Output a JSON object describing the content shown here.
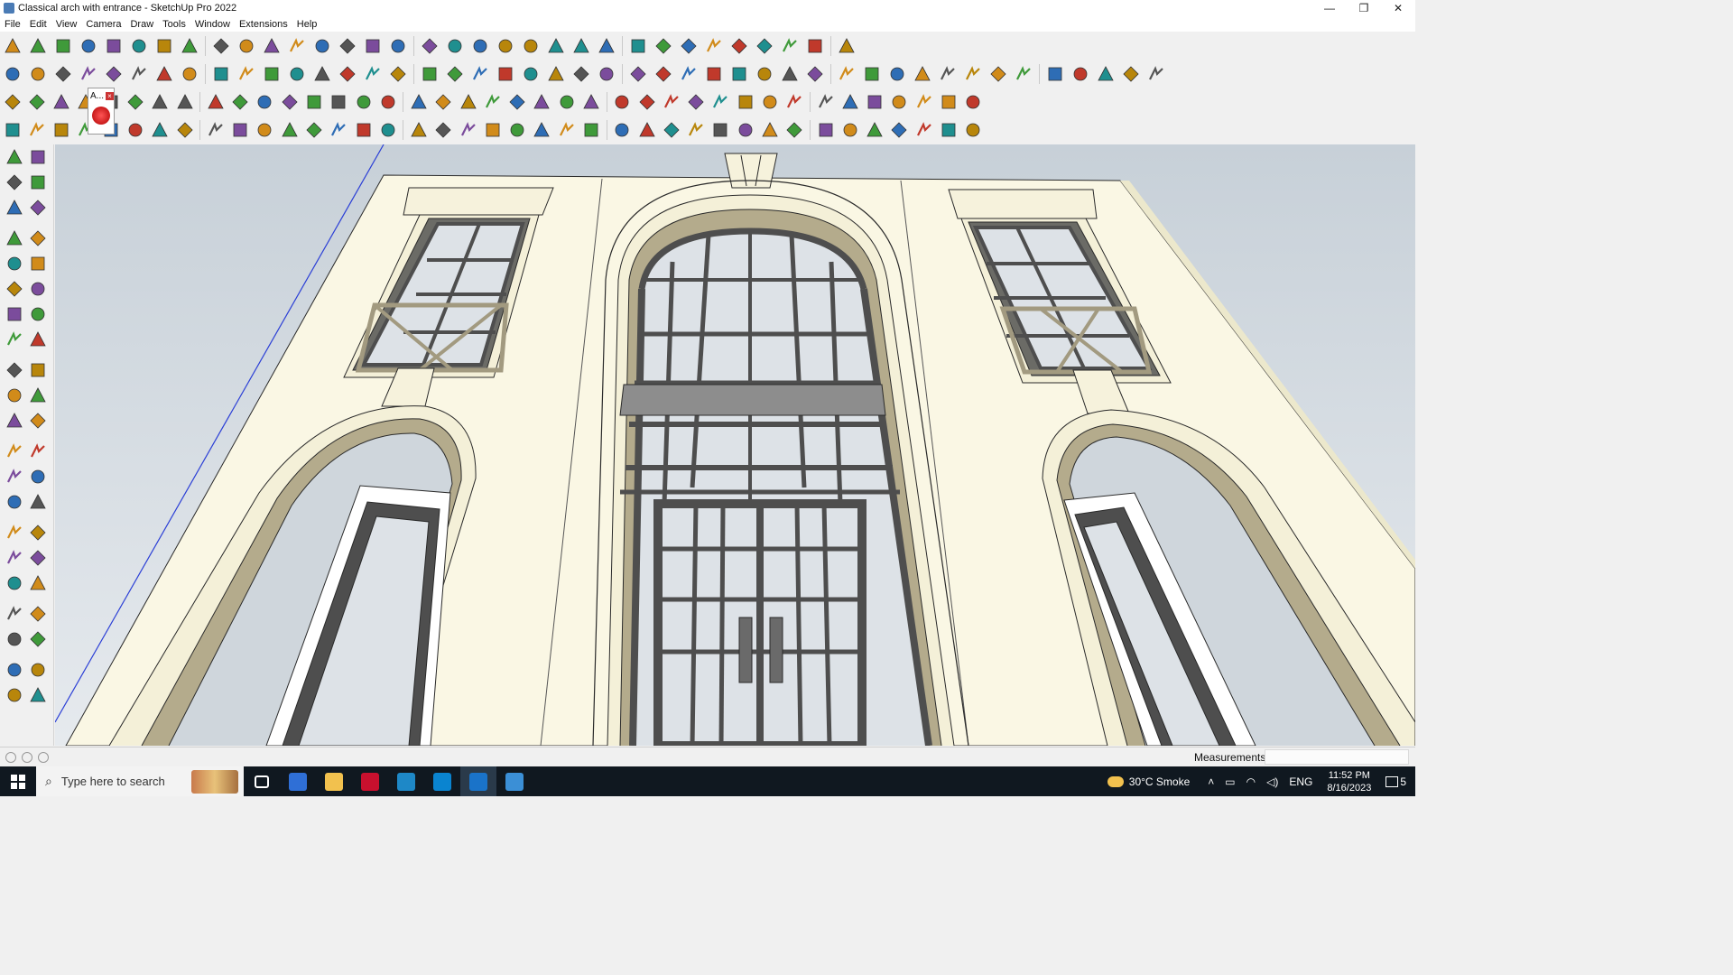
{
  "window": {
    "title": "Classical arch with entrance - SketchUp Pro 2022",
    "controls": [
      "—",
      "❐",
      "✕"
    ]
  },
  "menubar": [
    "File",
    "Edit",
    "View",
    "Camera",
    "Draw",
    "Tools",
    "Window",
    "Extensions",
    "Help"
  ],
  "toolbars": {
    "row1": [
      "zoom-icon",
      "select-icon",
      "eraser-icon",
      "pencil-icon",
      "arc-icon",
      "rectangle-icon",
      "push-pull-icon",
      "follow-me-icon",
      "move-icon",
      "rotate-icon",
      "scale-icon",
      "tape-measure-icon",
      "text-icon",
      "paint-bucket-icon",
      "orbit-icon",
      "pan-icon",
      "zoom-window-icon",
      "zoom-extents-icon",
      "x-ray-icon",
      "back-edges-icon",
      "wireframe-icon",
      "hidden-line-icon",
      "shaded-icon",
      "component-icon",
      "group-icon",
      "section-plane-icon",
      "flip-icon",
      "swap-icon",
      "measure-icon",
      "3d-warehouse-icon",
      "undo-icon",
      "redo-icon",
      "hand-stop-icon"
    ],
    "row2": [
      "cube-icon",
      "cube-gray-icon",
      "cube-white-icon",
      "push-icon",
      "arrow-n-icon",
      "arrow-e-icon",
      "arrow-r-icon",
      "arrow-g-icon",
      "arrow-k-icon",
      "arrow-o-icon",
      "arrow-p-icon",
      "curve-icon",
      "blue-panel-icon",
      "blue-panel-2-icon",
      "blue-panel-3-icon",
      "green-tile-icon",
      "green-node-icon",
      "house-1-icon",
      "house-2-icon",
      "house-3-icon",
      "house-4-icon",
      "house-5-icon",
      "house-6-icon",
      "fx-icon",
      "tag-icon",
      "ruler-icon",
      "shape-1-icon",
      "shape-2-icon",
      "shape-3-icon",
      "shape-4-icon",
      "shape-5-icon",
      "shape-6-icon",
      "shape-7-icon",
      "shape-8-icon",
      "shape-9-icon",
      "shape-10-icon",
      "red-pencil-icon",
      "red-eraser-icon",
      "material-1-icon",
      "material-2-icon",
      "material-3-icon",
      "material-4-icon",
      "material-5-icon",
      "material-6-icon",
      "material-7-icon"
    ],
    "row3": [
      "blue-cube-icon",
      "blue-flat-icon",
      "yellow-flat-icon",
      "panel-label-icon",
      "red-cube-icon",
      "paper-icon",
      "gold-loop-icon",
      "red-square-icon",
      "table-icon",
      "flag-icon",
      "wood-icon",
      "link-icon",
      "curve-2-icon",
      "spline-icon",
      "red-cross-icon",
      "green-cross-icon",
      "blue-x-icon",
      "cone-icon",
      "cone-2-icon",
      "warning-icon",
      "gold-arc-icon",
      "gold-arc-2-icon",
      "loop-icon",
      "star-icon",
      "barrel-icon",
      "red-magnet-icon",
      "green-pattern-icon",
      "red-door-icon",
      "red-door-2-icon",
      "red-door-3-icon",
      "red-gem-icon",
      "lattice-icon",
      "gray-box-icon",
      "orange-grid-icon",
      "orange-grid-2-icon",
      "orange-grid-3-icon",
      "close-x-icon",
      "dashed-curve-icon",
      "grid-icon"
    ],
    "row4": [
      "bezier-icon",
      "red-bezier-icon",
      "red-car-icon",
      "tool-1-icon",
      "tool-2-icon",
      "tool-3-icon",
      "tool-4-icon",
      "tool-5-icon",
      "tool-6-icon",
      "tool-7-icon",
      "tool-8-icon",
      "tool-9-icon",
      "tool-10-icon",
      "tool-11-icon",
      "tool-12-icon",
      "tool-13-icon",
      "tool-14-icon",
      "tool-15-icon",
      "tool-16-icon",
      "tool-17-icon",
      "tool-18-icon",
      "tool-19-icon",
      "tool-20-icon",
      "tool-21-icon",
      "tool-22-icon",
      "tool-23-icon",
      "tool-24-icon",
      "tool-25-icon",
      "tool-26-icon",
      "tool-27-icon",
      "tool-28-icon",
      "tool-29-icon",
      "tool-30-icon",
      "tool-31-icon",
      "tool-32-icon",
      "tool-33-icon",
      "tool-34-icon",
      "tool-35-icon",
      "tool-36-icon"
    ],
    "row3_popup_label": "A..."
  },
  "left_palette": [
    [
      "select-icon",
      "orbit-icon"
    ],
    [
      "paint-bucket-icon",
      "eraser-icon"
    ],
    [
      "component-icon",
      "tag-icon"
    ],
    [
      "line-icon",
      "freehand-icon"
    ],
    [
      "rectangle-icon",
      "rotated-rectangle-icon"
    ],
    [
      "circle-icon",
      "polygon-icon"
    ],
    [
      "arc-icon",
      "two-point-arc-icon"
    ],
    [
      "pie-icon",
      "three-point-arc-icon"
    ],
    [
      "move-icon",
      "push-pull-icon"
    ],
    [
      "rotate-icon",
      "follow-me-icon"
    ],
    [
      "scale-icon",
      "offset-icon"
    ],
    [
      "tape-measure-icon",
      "dimension-icon"
    ],
    [
      "protractor-icon",
      "text-icon"
    ],
    [
      "axes-icon",
      "3d-text-icon"
    ],
    [
      "orbit-tool-icon",
      "pan-tool-icon"
    ],
    [
      "zoom-tool-icon",
      "zoom-window-icon"
    ],
    [
      "zoom-extents-icon",
      "previous-view-icon"
    ],
    [
      "position-camera-icon",
      "look-around-icon"
    ],
    [
      "walk-icon",
      "section-plane-icon"
    ],
    [
      "x-ray-icon",
      "back-edges-icon"
    ],
    [
      "wireframe-icon",
      "hidden-line-icon"
    ]
  ],
  "statusbar": {
    "measurements_label": "Measurements",
    "measurements_value": ""
  },
  "taskbar": {
    "search_placeholder": "Type here to search",
    "apps": [
      "task-view-icon",
      "calculator-icon",
      "file-explorer-icon",
      "acrobat-icon",
      "app-3-icon",
      "edge-icon",
      "sketchup-icon",
      "layout-icon"
    ],
    "weather": "30°C  Smoke",
    "lang": "ENG",
    "time": "11:52 PM",
    "date": "8/16/2023",
    "notifications": "5"
  },
  "colors": {
    "wall": "#faf7e4",
    "wall_shade": "#ece8cc",
    "frame": "#4e4e4e",
    "glass": "#dde2e7",
    "sky": "#cfd6dc",
    "edge": "#2a2a2a",
    "axis_blue": "#2b3fd6"
  }
}
